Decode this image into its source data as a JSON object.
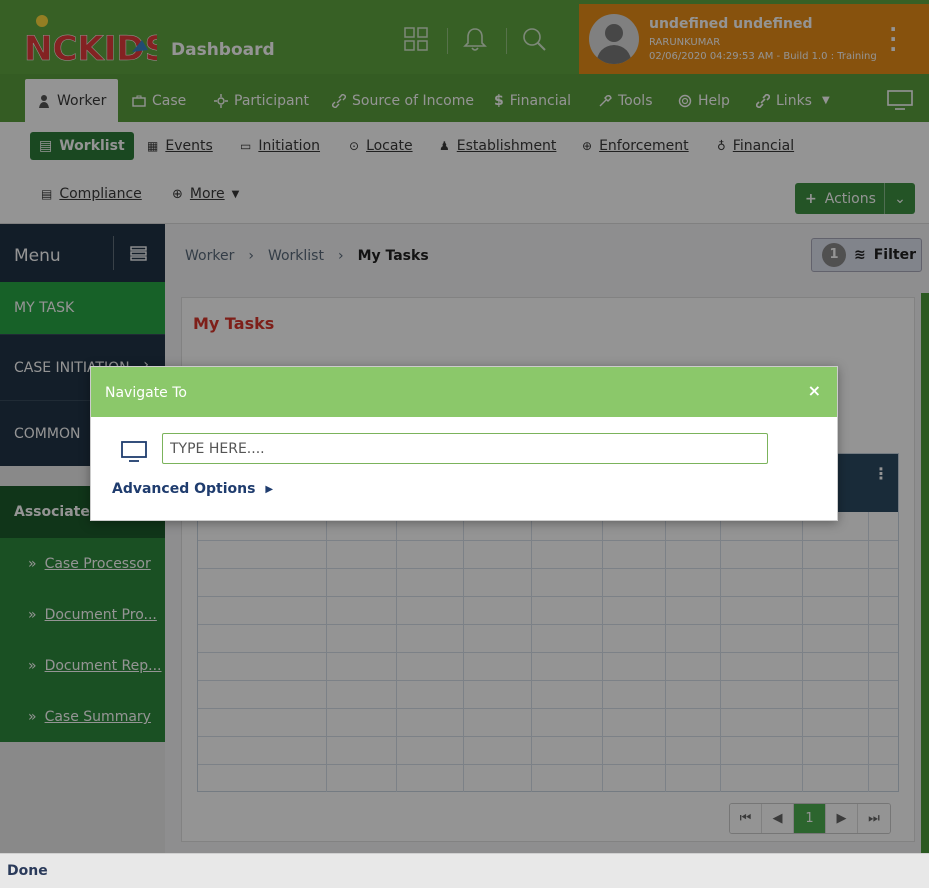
{
  "header": {
    "logo_text": "NCKIDS",
    "title": "Dashboard",
    "user": {
      "name": "undefined undefined",
      "id": "RARUNKUMAR",
      "timestamp": "02/06/2020 04:29:53 AM - Build 1.0 : Training"
    },
    "icons": [
      "grid-icon",
      "bell-icon",
      "search-icon",
      "kebab-menu-icon"
    ],
    "colors": {
      "header_green": "#5fa640",
      "user_orange": "#e88e17"
    }
  },
  "main_nav": {
    "tabs": [
      {
        "label": "Worker",
        "icon": "worker-icon"
      },
      {
        "label": "Case",
        "icon": "briefcase-icon"
      },
      {
        "label": "Participant",
        "icon": "participant-icon"
      },
      {
        "label": "Source of Income",
        "icon": "link-icon"
      },
      {
        "label": "Financial",
        "icon": "dollar-icon"
      },
      {
        "label": "Tools",
        "icon": "tools-icon"
      },
      {
        "label": "Help",
        "icon": "help-icon"
      },
      {
        "label": "Links",
        "icon": "chain-icon"
      }
    ]
  },
  "sub_nav": {
    "items": [
      {
        "label": "Worklist",
        "icon": "list-icon"
      },
      {
        "label": "Events",
        "icon": "calendar-icon"
      },
      {
        "label": "Initiation",
        "icon": "inbox-icon"
      },
      {
        "label": "Locate",
        "icon": "map-pin-icon"
      },
      {
        "label": "Establishment",
        "icon": "person-icon"
      },
      {
        "label": "Enforcement",
        "icon": "target-icon"
      },
      {
        "label": "Financial",
        "icon": "money-bag-icon"
      },
      {
        "label": "Compliance",
        "icon": "document-icon"
      },
      {
        "label": "More",
        "icon": "plus-circle-icon"
      }
    ],
    "actions_label": "Actions"
  },
  "sidebar": {
    "menu_title": "Menu",
    "items": [
      {
        "label": "MY TASK"
      },
      {
        "label": "CASE INITIATION"
      },
      {
        "label": "COMMON"
      }
    ],
    "associated_title": "Associated",
    "associated_items": [
      {
        "label": "Case Processor"
      },
      {
        "label": "Document Pro..."
      },
      {
        "label": "Document Rep..."
      },
      {
        "label": "Case Summary"
      }
    ]
  },
  "content": {
    "breadcrumb": [
      "Worker",
      "Worklist",
      "My Tasks"
    ],
    "filter": {
      "count": "1",
      "label": "Filter"
    },
    "panel_title": "My Tasks",
    "pager": {
      "current": "1"
    }
  },
  "modal": {
    "title": "Navigate To",
    "close": "×",
    "input_placeholder": "TYPE HERE....",
    "input_value": "",
    "advanced_label": "Advanced Options"
  },
  "status": {
    "text": "Done"
  }
}
